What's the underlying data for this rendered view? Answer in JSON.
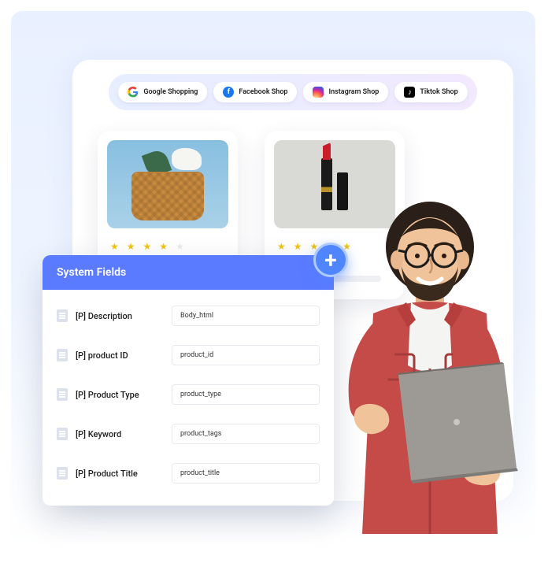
{
  "platforms": [
    {
      "label": "Google Shopping",
      "icon": "google"
    },
    {
      "label": "Facebook Shop",
      "icon": "facebook"
    },
    {
      "label": "Instagram Shop",
      "icon": "instagram"
    },
    {
      "label": "Tiktok Shop",
      "icon": "tiktok"
    }
  ],
  "products": [
    {
      "image": "basket",
      "stars": [
        true,
        true,
        true,
        true,
        false
      ]
    },
    {
      "image": "lipstick",
      "stars": [
        true,
        true,
        true,
        true,
        true
      ]
    }
  ],
  "system_fields": {
    "header": "System Fields",
    "rows": [
      {
        "label": "[P] Description",
        "value": "Body_html"
      },
      {
        "label": "[P] product ID",
        "value": "product_id"
      },
      {
        "label": "[P] Product Type",
        "value": "product_type"
      },
      {
        "label": "[P] Keyword",
        "value": "product_tags"
      },
      {
        "label": "[P] Product Title",
        "value": "product_title"
      }
    ]
  }
}
